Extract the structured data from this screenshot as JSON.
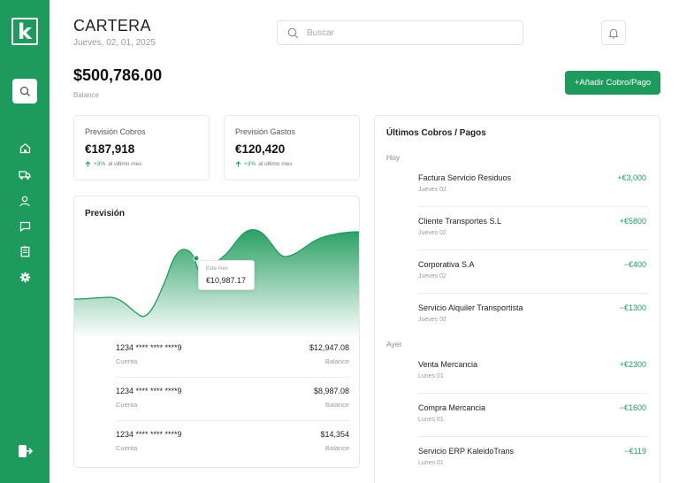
{
  "sidebar": {
    "logo_letter": "k",
    "search_icon": "search-icon",
    "nav": [
      "home-icon",
      "truck-icon",
      "user-icon",
      "chat-icon",
      "document-icon",
      "gear-icon"
    ],
    "logout_icon": "logout-icon"
  },
  "header": {
    "title": "CARTERA",
    "date": "Jueves, 02, 01, 2025",
    "search_placeholder": "Buscar",
    "bell_icon": "bell-icon"
  },
  "summary": {
    "balance": "$500,786.00",
    "balance_label": "Balance",
    "add_button": "+Añadir Cobro/Pago"
  },
  "stats": [
    {
      "label": "Previsión Cobros",
      "value": "€187,918",
      "trend_pct": "+3%",
      "trend_text": "al último mes"
    },
    {
      "label": "Previsión Gastos",
      "value": "€120,420",
      "trend_pct": "+3%",
      "trend_text": "al último mes"
    }
  ],
  "forecast": {
    "title": "Previsión",
    "tooltip_label": "Este mes",
    "tooltip_value": "€10,987.17",
    "accounts": [
      {
        "number": "1234 **** **** ****9",
        "sub": "Cuenta",
        "amount": "$12,947.08",
        "amount_label": "Balance"
      },
      {
        "number": "1234 **** **** ****9",
        "sub": "Cuenta",
        "amount": "$8,987.08",
        "amount_label": "Balance"
      },
      {
        "number": "1234 **** **** ****9",
        "sub": "Cuenta",
        "amount": "$14,354",
        "amount_label": "Balance"
      }
    ]
  },
  "transactions": {
    "title": "Últimos Cobros / Pagos",
    "groups": [
      {
        "label": "Hoy",
        "items": [
          {
            "name": "Factura Servicio Residuos",
            "date": "Jueves 02",
            "amount": "+€3,000"
          },
          {
            "name": "Cliente Transportes S.L",
            "date": "Jueves 02",
            "amount": "+€5800"
          },
          {
            "name": "Corporativa S.A",
            "date": "Jueves 02",
            "amount": "−€400"
          },
          {
            "name": "Servicio Alquiler Transportista",
            "date": "Jueves 02",
            "amount": "−€1300"
          }
        ]
      },
      {
        "label": "Ayer",
        "items": [
          {
            "name": "Venta Mercancia",
            "date": "Lunes 01",
            "amount": "+€2300"
          },
          {
            "name": "Compra Mercancia",
            "date": "Lunes 01",
            "amount": "−€1600"
          },
          {
            "name": "Servicio ERP KaleidoTrans",
            "date": "Lunes 01",
            "amount": "−€119"
          }
        ]
      }
    ]
  },
  "colors": {
    "accent": "#1e9b5c",
    "sidebar": "#1e9b5c"
  }
}
